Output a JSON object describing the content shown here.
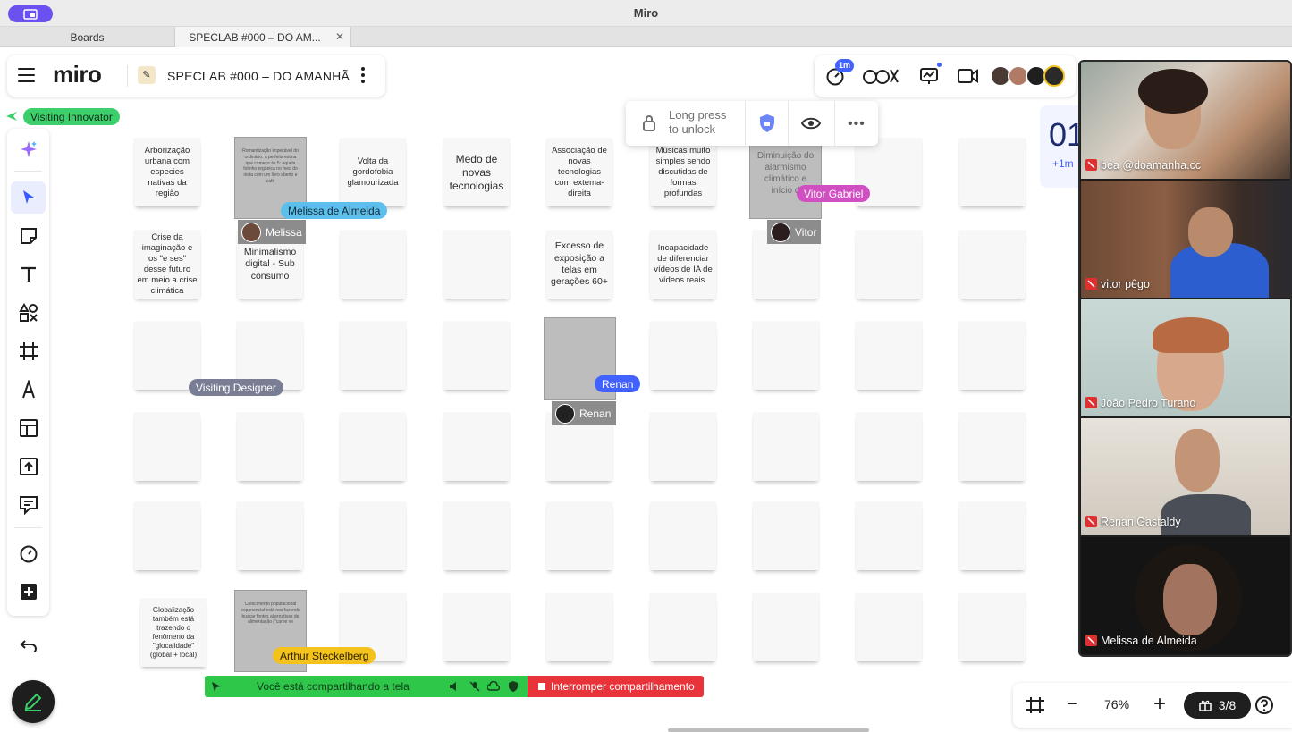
{
  "window": {
    "title": "Miro"
  },
  "tabs": [
    {
      "label": "Boards"
    },
    {
      "label": "SPECLAB #000 – DO AM..."
    }
  ],
  "board": {
    "logo": "miro",
    "name": "SPECLAB #000 – DO AMANHÃ",
    "visiting_label": "Visiting Innovator"
  },
  "collab": {
    "timer_badge": "1m"
  },
  "lock_popover": {
    "line1": "Long press",
    "line2": "to unlock"
  },
  "timer_panel": {
    "value": "01",
    "add": "+1m"
  },
  "notes": {
    "n1": "Arborização urbana com especies nativas da região",
    "n2": "Romantização impecável do ordinário: a perfeita estina que começa às 5: aquela fotinho orgânica no feed do insta com um livro aberto e café",
    "n3": "Volta da gordofobia glamourizada",
    "n4": "Medo de novas tecnologias",
    "n5": "Associação de novas tecnologias com extema-direita",
    "n6": "Músicas muito simples sendo discutidas de formas profundas",
    "n7": "Diminuição do alarmismo climático e início d",
    "n8": "Crise da imaginação e os \"e ses\" desse futuro em meio a crise climática",
    "n9": "Minimalismo digital - Sub consumo",
    "n10": "Excesso de exposição a telas em gerações 60+",
    "n11": "Incapacidade de diferenciar vídeos de IA de vídeos reais.",
    "n12": "Globalização também está trazendo o fenômeno da \"glocalidade\" (global + local)",
    "n13": "Crescimento populacional exponencial está nos fazendo buscar fontes alternativas de alimentação (\"carne ve"
  },
  "editor_chips": {
    "melissa": "Melissa",
    "vitor": "Vitor",
    "renan": "Renan"
  },
  "cursors": {
    "melissa": {
      "label": "Melissa de Almeida",
      "color": "#5dc0ec"
    },
    "vitor": {
      "label": "Vitor Gabriel",
      "color": "#d04fc1"
    },
    "designer": {
      "label": "Visiting Designer",
      "color": "#7a7e95"
    },
    "renan": {
      "label": "Renan",
      "color": "#4262ff"
    },
    "arthur": {
      "label": "Arthur Steckelberg",
      "color": "#f4c21c"
    }
  },
  "participants": [
    {
      "name": "béa @doamanha.cc"
    },
    {
      "name": "vitor pêgo"
    },
    {
      "name": "João Pedro Turano"
    },
    {
      "name": "Renan Gastaldy"
    },
    {
      "name": "Melissa de Almeida"
    }
  ],
  "share_banner": {
    "message": "Você está compartilhando a tela",
    "stop": "Interromper compartilhamento"
  },
  "zoom": {
    "level": "76%",
    "gifts": "3/8"
  },
  "colors": {
    "accent": "#4262ff",
    "share_green": "#2ec74a",
    "share_red": "#e8333a",
    "visiting_green": "#3ccf6b"
  }
}
